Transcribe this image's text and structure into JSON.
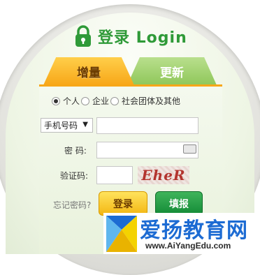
{
  "header": {
    "title": "登录 Login"
  },
  "tabs": [
    {
      "label": "增量",
      "active": true
    },
    {
      "label": "更新",
      "active": false
    }
  ],
  "account_type": {
    "options": [
      "个人",
      "企业",
      "社会团体及其他"
    ],
    "selected": "个人"
  },
  "form": {
    "id_type_select": "手机号码",
    "phone_value": "",
    "password_label": "密 码:",
    "password_value": "",
    "captcha_label": "验证码:",
    "captcha_value": "",
    "captcha_image_text": "EheR"
  },
  "actions": {
    "forgot_label": "忘记密码?",
    "login_label": "登录",
    "fill_label": "填报"
  },
  "watermark": {
    "name": "爱扬教育网",
    "url": "www.AiYangEdu.com"
  },
  "colors": {
    "brand_green": "#2f9a38",
    "tab_orange": "#f7a718",
    "tab_green": "#8fc75a",
    "logo_blue": "#1c6bd3"
  }
}
